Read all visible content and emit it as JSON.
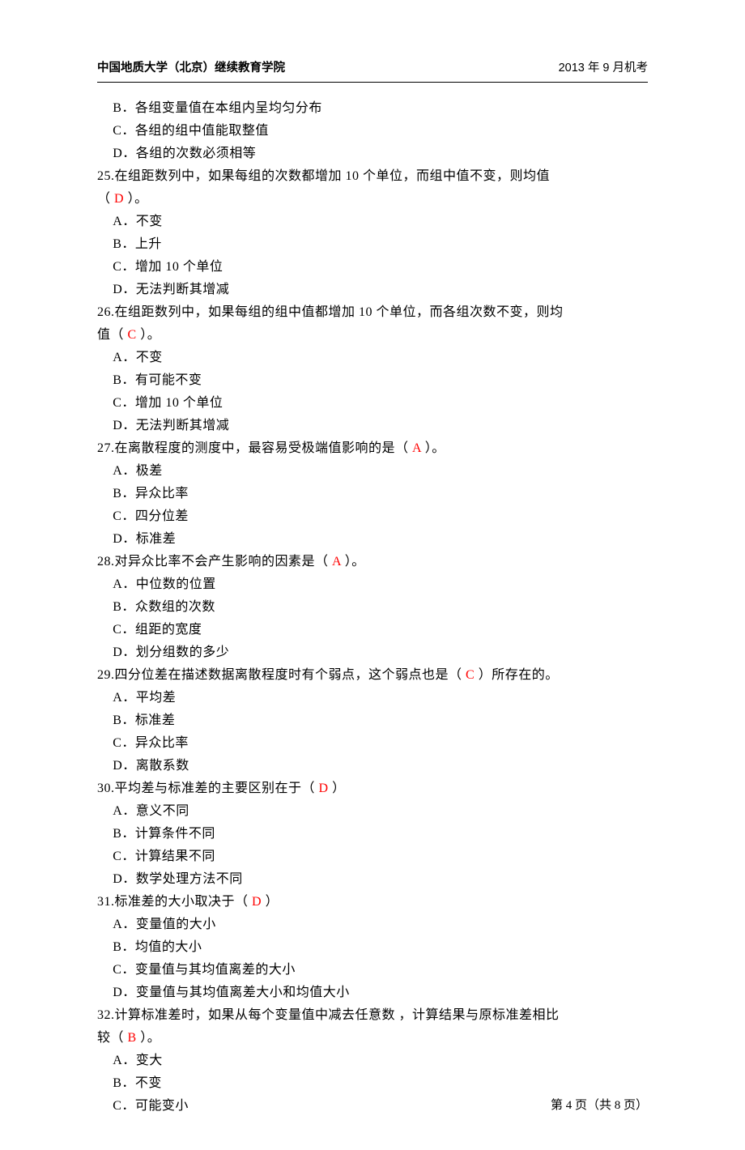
{
  "header": {
    "left": "中国地质大学（北京）继续教育学院",
    "right": "2013 年 9 月机考"
  },
  "pre_options": {
    "B": "B．各组变量值在本组内呈均匀分布",
    "C": "C．各组的组中值能取整值",
    "D": "D．各组的次数必须相等"
  },
  "q25": {
    "line1": "25.在组距数列中，如果每组的次数都增加 10 个单位，而组中值不变，则均值",
    "line2_pre": "（  ",
    "ans": "D",
    "line2_post": "  ）。",
    "A": "A．不变",
    "B": "B．上升",
    "C": "C．增加 10 个单位",
    "D": "D．无法判断其增减"
  },
  "q26": {
    "line1": "26.在组距数列中，如果每组的组中值都增加 10 个单位，而各组次数不变，则均",
    "line2_pre": "值（  ",
    "ans": "C",
    "line2_post": "  ）。",
    "A": "A．不变",
    "B": "B．有可能不变",
    "C": "C．增加 10 个单位",
    "D": "D．无法判断其增减"
  },
  "q27": {
    "pre": "27.在离散程度的测度中，最容易受极端值影响的是（  ",
    "ans": "A",
    "post": "  ）。",
    "A": "A．极差",
    "B": "B．异众比率",
    "C": "C．四分位差",
    "D": "D．标准差"
  },
  "q28": {
    "pre": "28.对异众比率不会产生影响的因素是（  ",
    "ans": "A",
    "post": "  ）。",
    "A": "A．中位数的位置",
    "B": "B．众数组的次数",
    "C": "C．组距的宽度",
    "D": "D．划分组数的多少"
  },
  "q29": {
    "pre": "29.四分位差在描述数据离散程度时有个弱点，这个弱点也是（  ",
    "ans": "C",
    "post": "  ）所存在的。",
    "A": "A．平均差",
    "B": "B．标准差",
    "C": "C．异众比率",
    "D": "D．离散系数"
  },
  "q30": {
    "pre": "30.平均差与标准差的主要区别在于（  ",
    "ans": "D",
    "post": "  ）",
    "A": "A．意义不同",
    "B": "B．计算条件不同",
    "C": "C．计算结果不同",
    "D": "D．数学处理方法不同"
  },
  "q31": {
    "pre": "31.标准差的大小取决于（  ",
    "ans": "D",
    "post": "  ）",
    "A": "A．变量值的大小",
    "B": "B．均值的大小",
    "C": "C．变量值与其均值离差的大小",
    "D": "D．变量值与其均值离差大小和均值大小"
  },
  "q32": {
    "line1": "32.计算标准差时，如果从每个变量值中减去任意数  ，计算结果与原标准差相比",
    "line2_pre": "较（  ",
    "ans": "B",
    "line2_post": "  ）。",
    "A": "A．变大",
    "B": "B．不变",
    "C": "C．可能变小"
  },
  "footer": "第 4 页（共 8 页）"
}
